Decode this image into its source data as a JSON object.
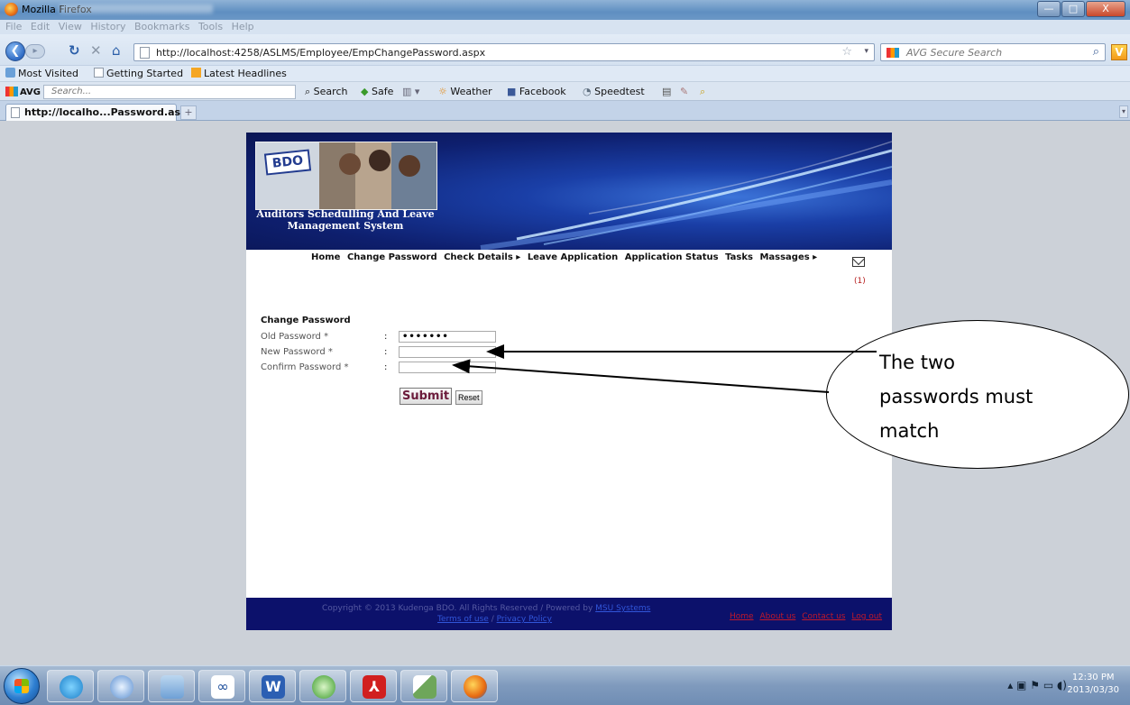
{
  "window": {
    "title": "Mozilla Firefox",
    "buttons": {
      "minimize": "—",
      "maximize": "□",
      "close": "X"
    }
  },
  "menubar": [
    "File",
    "Edit",
    "View",
    "History",
    "Bookmarks",
    "Tools",
    "Help"
  ],
  "navigation": {
    "back_label": "❮",
    "forward_label": "▸",
    "url": "http://localhost:4258/ASLMS/Employee/EmpChangePassword.aspx",
    "search_placeholder": "AVG Secure Search"
  },
  "bookmarks": [
    "Most Visited",
    "Getting Started",
    "Latest Headlines"
  ],
  "avg_toolbar": {
    "logo": "AVG",
    "search_placeholder": "Search...",
    "items": [
      "Search",
      "Safe",
      "Weather",
      "Facebook",
      "Speedtest"
    ]
  },
  "tab": {
    "title": "http://localho...Password.aspx",
    "new_tab": "+"
  },
  "site": {
    "brand_line1": "Auditors Schedulling And Leave",
    "brand_line2": "Management System",
    "logo_text": "BDO",
    "menu": [
      "Home",
      "Change Password",
      "Check Details ▸",
      "Leave Application",
      "Application Status",
      "Tasks",
      "Massages ▸"
    ],
    "mail_count": "(1)"
  },
  "form": {
    "title": "Change Password",
    "fields": [
      {
        "label": "Old Password *",
        "value": "•••••••"
      },
      {
        "label": "New Password *",
        "value": ""
      },
      {
        "label": "Confirm Password *",
        "value": ""
      }
    ],
    "colon": ":",
    "submit_label": "Submit",
    "reset_label": "Reset"
  },
  "footer": {
    "copyright": "Copyright © 2013 Kudenga BDO. All Rights Reserved / Powered by",
    "powered_link": "MSU Systems",
    "terms": "Terms of use",
    "privacy": "Privacy Policy",
    "separator": " / ",
    "links": [
      "Home",
      "About us",
      "Contact us",
      "Log out"
    ]
  },
  "annotation": {
    "lines": [
      "The two",
      "passwords must",
      "match"
    ]
  },
  "taskbar": {
    "time": "12:30 PM",
    "date": "2013/03/30"
  }
}
